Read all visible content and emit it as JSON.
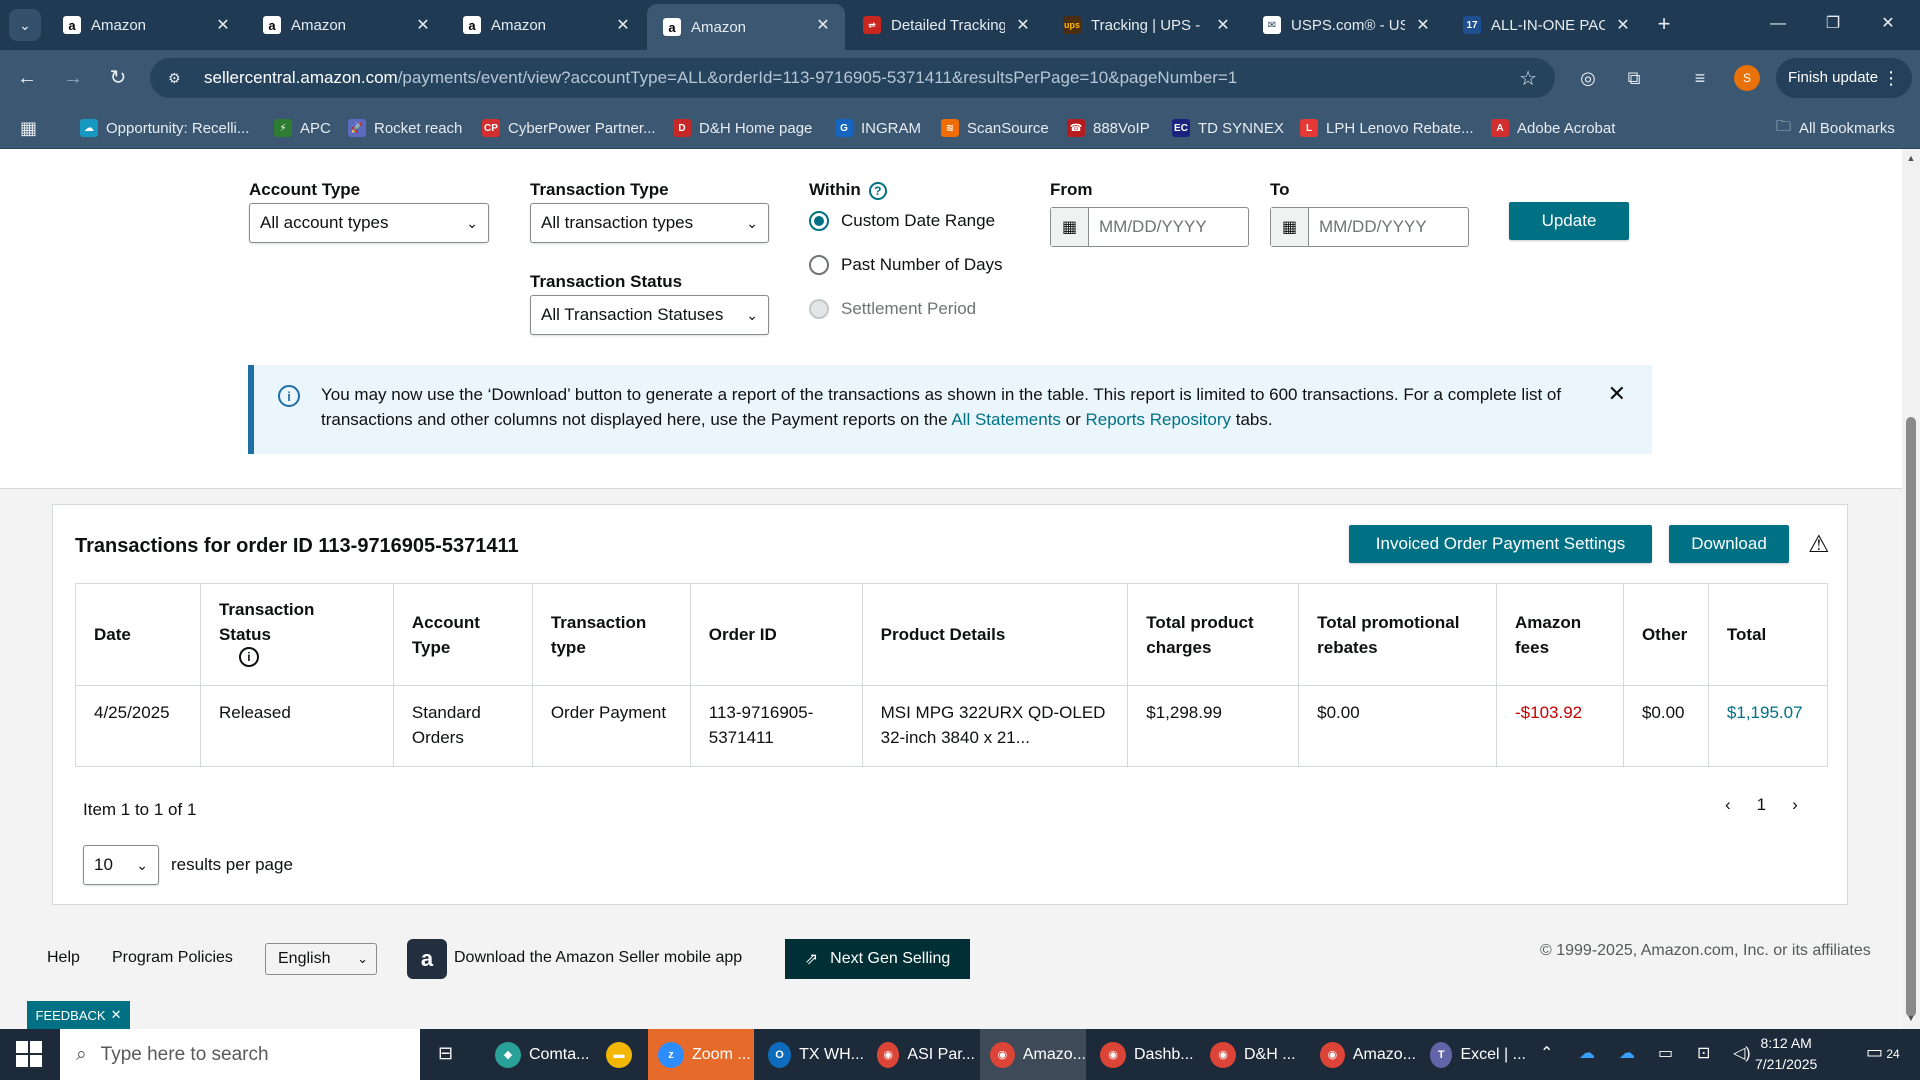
{
  "browser": {
    "tabs": [
      {
        "title": "Amazon",
        "favicon": "amazon-icon",
        "active": false
      },
      {
        "title": "Amazon",
        "favicon": "amazon-icon",
        "active": false
      },
      {
        "title": "Amazon",
        "favicon": "amazon-icon",
        "active": false
      },
      {
        "title": "Amazon",
        "favicon": "amazon-icon",
        "active": true
      },
      {
        "title": "Detailed Tracking",
        "favicon": "tracking-icon",
        "active": false
      },
      {
        "title": "Tracking | UPS - U",
        "favicon": "ups-icon",
        "active": false
      },
      {
        "title": "USPS.com® - US",
        "favicon": "usps-icon",
        "active": false
      },
      {
        "title": "ALL-IN-ONE PAC",
        "favicon": "allinone-icon",
        "active": false
      }
    ],
    "url_host": "sellercentral.amazon.com",
    "url_path": "/payments/event/view?accountType=ALL&orderId=113-9716905-5371411&resultsPerPage=10&pageNumber=1",
    "profile_initial": "S",
    "finish_update_label": "Finish update",
    "bookmarks": [
      {
        "label": "Opportunity: Recelli...",
        "color": "#1798c1"
      },
      {
        "label": "APC",
        "color": "#2e7d32"
      },
      {
        "label": "Rocket reach",
        "color": "#5c6bc0"
      },
      {
        "label": "CyberPower Partner...",
        "color": "#d32f2f"
      },
      {
        "label": "D&H Home page",
        "color": "#c62828"
      },
      {
        "label": "INGRAM",
        "color": "#1565c0"
      },
      {
        "label": "ScanSource",
        "color": "#ef6c00"
      },
      {
        "label": "888VoIP",
        "color": "#b71c1c"
      },
      {
        "label": "TD SYNNEX",
        "color": "#1a237e"
      },
      {
        "label": "LPH Lenovo Rebate...",
        "color": "#e53935"
      },
      {
        "label": "Adobe Acrobat",
        "color": "#d32f2f"
      }
    ],
    "bookmark_icons": [
      "salesforce-icon",
      "apc-icon",
      "rocket-icon",
      "cp-icon",
      "dh-icon",
      "ingram-icon",
      "scansource-icon",
      "voip-icon",
      "ec-icon",
      "lenovo-icon",
      "acrobat-icon"
    ],
    "bookmark_glyphs": [
      "☁",
      "⚡",
      "🚀",
      "CP",
      "D",
      "G",
      "≋",
      "☎",
      "EC",
      "L",
      "A"
    ],
    "all_bookmarks_label": "All Bookmarks"
  },
  "filters": {
    "account_type_label": "Account Type",
    "account_type_value": "All account types",
    "transaction_type_label": "Transaction Type",
    "transaction_type_value": "All transaction types",
    "transaction_status_label": "Transaction Status",
    "transaction_status_value": "All Transaction Statuses",
    "within_label": "Within",
    "within_options": [
      {
        "label": "Custom Date Range",
        "checked": true,
        "disabled": false
      },
      {
        "label": "Past Number of Days",
        "checked": false,
        "disabled": false
      },
      {
        "label": "Settlement Period",
        "checked": false,
        "disabled": true
      }
    ],
    "from_label": "From",
    "to_label": "To",
    "date_placeholder": "MM/DD/YYYY",
    "update_label": "Update"
  },
  "alert": {
    "text_before": "You may now use the ‘Download’ button to generate a report of the transactions as shown in the table. This report is limited to 600 transactions. For a complete list of transactions and other columns not displayed here, use the Payment reports on the ",
    "link1": "All Statements",
    "text_middle": " or ",
    "link2": "Reports Repository",
    "text_after": " tabs."
  },
  "transactions": {
    "title": "Transactions for order ID 113-9716905-5371411",
    "invoiced_settings_label": "Invoiced Order Payment Settings",
    "download_label": "Download",
    "columns": [
      "Date",
      "Transaction Status",
      "Account Type",
      "Transaction type",
      "Order ID",
      "Product Details",
      "Total product charges",
      "Total promotional rebates",
      "Amazon fees",
      "Other",
      "Total"
    ],
    "rows": [
      {
        "date": "4/25/2025",
        "status": "Released",
        "account_type": "Standard Orders",
        "transaction_type": "Order Payment",
        "order_id": "113-9716905-5371411",
        "product_details": "MSI MPG 322URX QD-OLED 32-inch 3840 x 21...",
        "product_charges": "$1,298.99",
        "promo_rebates": "$0.00",
        "amazon_fees": "-$103.92",
        "other": "$0.00",
        "total": "$1,195.07"
      }
    ],
    "summary": "Item 1 to 1 of 1",
    "current_page": "1",
    "per_page_value": "10",
    "per_page_label": "results per page"
  },
  "footer": {
    "help": "Help",
    "program_policies": "Program Policies",
    "language": "English",
    "mobile_app": "Download the Amazon Seller mobile app",
    "next_gen": "Next Gen Selling",
    "copyright": "© 1999-2025, Amazon.com, Inc. or its affiliates",
    "feedback": "FEEDBACK"
  },
  "taskbar": {
    "search_placeholder": "Type here to search",
    "apps": [
      {
        "label": "Comta...",
        "color": "#2aa198"
      },
      {
        "label": "",
        "color": "#f2b705"
      },
      {
        "label": "Zoom ...",
        "color": "#2d8cff"
      },
      {
        "label": "TX WH...",
        "color": "#0f6cbd"
      },
      {
        "label": "ASI Par...",
        "color": "#db4437"
      },
      {
        "label": "Amazo...",
        "color": "#db4437"
      },
      {
        "label": "Dashb...",
        "color": "#db4437"
      },
      {
        "label": "D&H ...",
        "color": "#db4437"
      },
      {
        "label": "Amazo...",
        "color": "#db4437"
      },
      {
        "label": "Excel | ...",
        "color": "#6264a7"
      }
    ],
    "app_icons": [
      "comtact-icon",
      "file-explorer-icon",
      "zoom-icon",
      "outlook-icon",
      "chrome-icon",
      "chrome-icon",
      "chrome-icon",
      "chrome-icon",
      "chrome-icon",
      "teams-icon"
    ],
    "time": "8:12 AM",
    "date": "7/21/2025",
    "notifications": "24"
  }
}
